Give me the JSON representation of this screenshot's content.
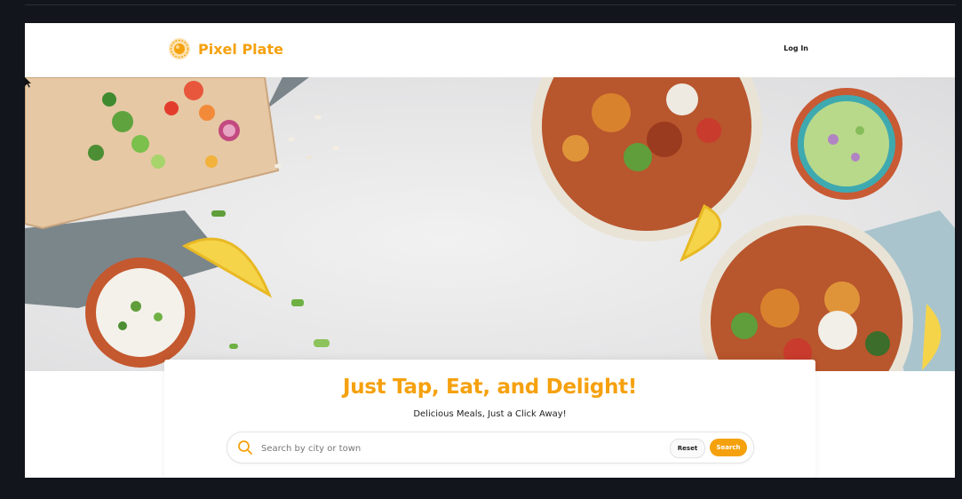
{
  "brand": {
    "name": "Pixel Plate",
    "logo_icon": "plate-logo-icon"
  },
  "nav": {
    "login_label": "Log In"
  },
  "hero": {
    "image": "food-flatlay-image"
  },
  "content": {
    "headline": "Just Tap, Eat, and Delight!",
    "subheadline": "Delicious Meals, Just a Click Away!"
  },
  "search": {
    "placeholder": "Search by city or town",
    "value": "",
    "reset_label": "Reset",
    "search_label": "Search",
    "icon": "search-icon"
  },
  "colors": {
    "accent": "#f5a10e",
    "background": "#12151b"
  }
}
